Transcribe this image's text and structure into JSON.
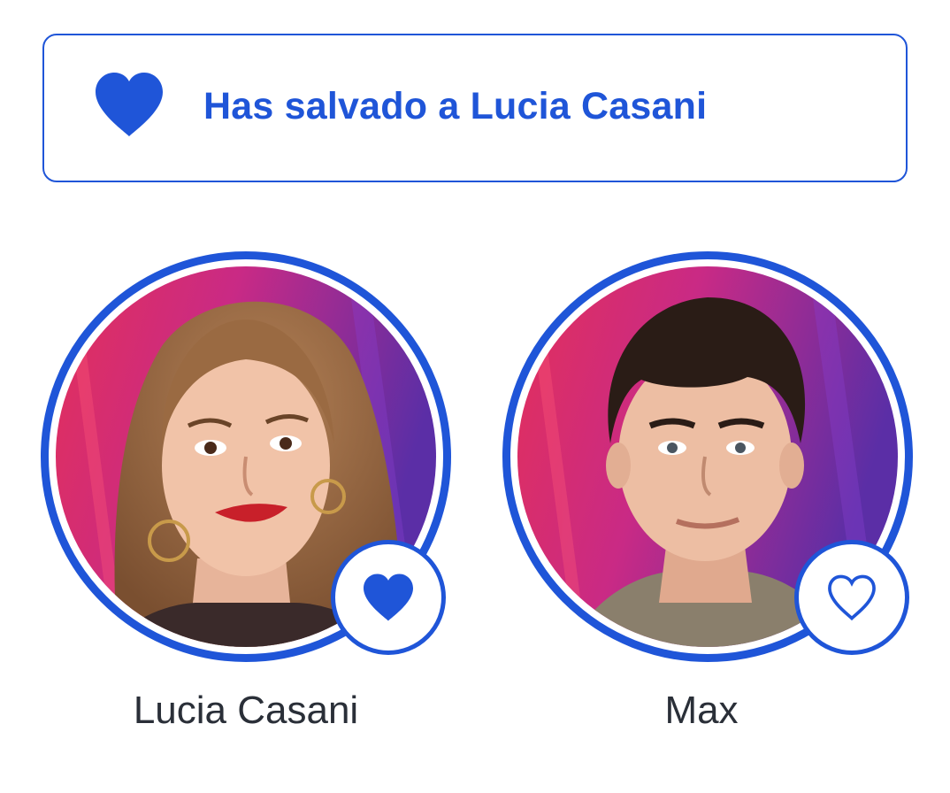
{
  "banner": {
    "icon": "heart-filled-icon",
    "message": "Has salvado a Lucia Casani"
  },
  "contestants": [
    {
      "name": "Lucia Casani",
      "vote_icon": "heart-filled-icon",
      "saved": true
    },
    {
      "name": "Max",
      "vote_icon": "heart-outline-icon",
      "saved": false
    }
  ],
  "colors": {
    "accent": "#1f55d8",
    "name_text": "#2a2f38",
    "photo_bg_pink": "#d8285e",
    "photo_bg_purple": "#6a2fa8"
  }
}
